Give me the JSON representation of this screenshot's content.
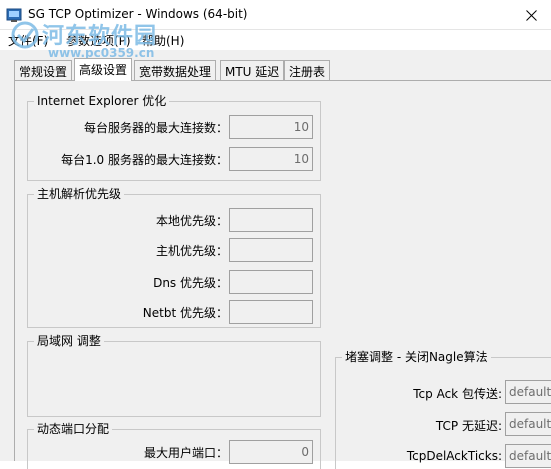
{
  "window": {
    "title": "SG TCP Optimizer - Windows (64-bit)"
  },
  "menu": {
    "file": "文件(F)",
    "params": "参数选项(P)",
    "help": "帮助(H)"
  },
  "watermark": {
    "line1": "河东软件园",
    "line2": "www.pc0359.cn"
  },
  "tabs": [
    "常规设置",
    "高级设置",
    "宽带数据处理",
    "MTU 延迟",
    "注册表"
  ],
  "ie_group": {
    "title": "Internet Explorer 优化",
    "max_conn_label": "每台服务器的最大连接数：",
    "max_conn_value": "10",
    "max_conn10_label": "每台1.0 服务器的最大连接数：",
    "max_conn10_value": "10"
  },
  "priority_group": {
    "title": "主机解析优先级",
    "local_label": "本地优先级：",
    "local_value": "",
    "host_label": "主机优先级：",
    "host_value": "",
    "dns_label": "Dns 优先级：",
    "dns_value": "",
    "netbt_label": "Netbt 优先级：",
    "netbt_value": ""
  },
  "lan_group": {
    "title": "局域网 调整"
  },
  "port_group": {
    "title": "动态端口分配",
    "max_port_label": "最大用户端口：",
    "max_port_value": "0"
  },
  "congestion_group": {
    "title": "堵塞调整 - 关闭Nagle算法",
    "ack_label": "Tcp Ack 包传送:",
    "ack_value": "default:",
    "nodelay_label": "TCP 无延迟:",
    "nodelay_value": "default:",
    "delack_label": "TcpDelAckTicks:",
    "delack_value": "default:"
  },
  "colors": {
    "accent": "#0078d7",
    "watermark": "#7dbbe6"
  }
}
